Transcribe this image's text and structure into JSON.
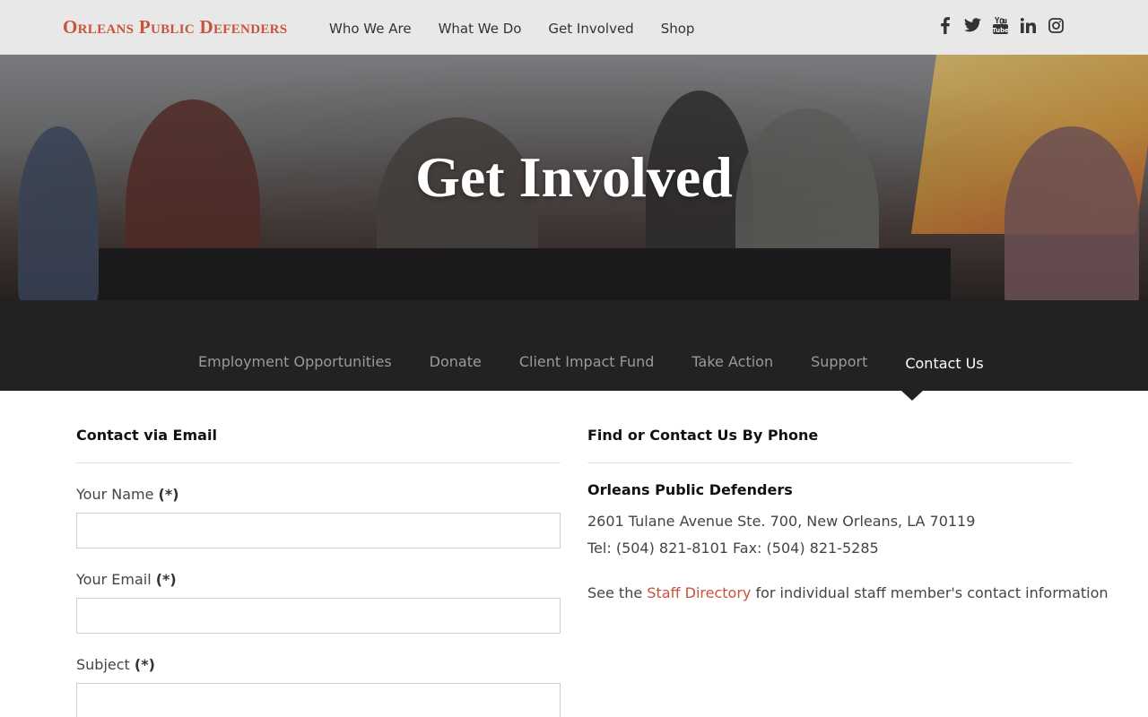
{
  "site": {
    "logo_text": "Orleans Public Defenders",
    "brand_color": "#c9523a"
  },
  "main_nav": {
    "items": [
      {
        "label": "Who We Are"
      },
      {
        "label": "What We Do"
      },
      {
        "label": "Get Involved"
      },
      {
        "label": "Shop"
      }
    ]
  },
  "social": {
    "icons": [
      "facebook-icon",
      "twitter-icon",
      "youtube-icon",
      "linkedin-icon",
      "instagram-icon"
    ]
  },
  "hero": {
    "title": "Get Involved"
  },
  "sub_nav": {
    "items": [
      {
        "label": "Employment Opportunities",
        "active": false
      },
      {
        "label": "Donate",
        "active": false
      },
      {
        "label": "Client Impact Fund",
        "active": false
      },
      {
        "label": "Take Action",
        "active": false
      },
      {
        "label": "Support",
        "active": false
      },
      {
        "label": "Contact Us",
        "active": true
      }
    ]
  },
  "contact_email": {
    "heading": "Contact via Email",
    "required_marker": "(*)",
    "fields": [
      {
        "label": "Your Name",
        "value": ""
      },
      {
        "label": "Your Email",
        "value": ""
      },
      {
        "label": "Subject",
        "value": ""
      }
    ]
  },
  "contact_phone": {
    "heading": "Find or Contact Us By Phone",
    "org_name": "Orleans Public Defenders",
    "address": "2601 Tulane Avenue Ste. 700, New Orleans, LA 70119",
    "phone_line": "Tel: (504) 821-8101 Fax: (504) 821-5285",
    "staff_prefix": "See the ",
    "staff_link": "Staff Directory",
    "staff_suffix": " for individual staff member's contact information"
  }
}
